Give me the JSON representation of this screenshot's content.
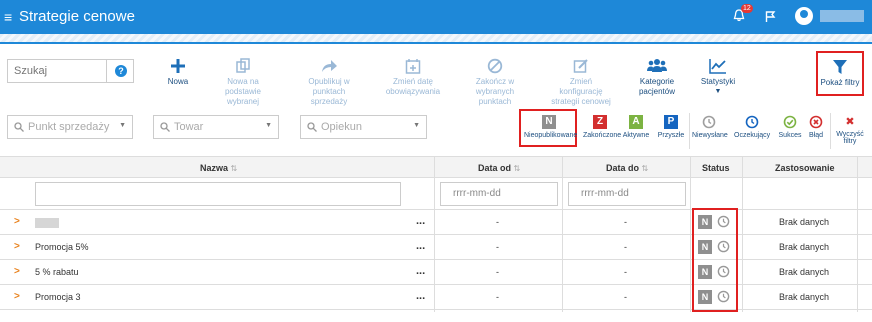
{
  "header": {
    "menu_icon": "≡",
    "title": "Strategie cenowe",
    "notifications": "12"
  },
  "search": {
    "placeholder": "Szukaj",
    "help": "?"
  },
  "toolbar": [
    {
      "label": "Nowa",
      "icon": "plus-icon"
    },
    {
      "label": "Nowa na podstawie wybranej",
      "icon": "copy-icon"
    },
    {
      "label": "Opublikuj w punktach sprzedaży",
      "icon": "share-arrow-icon"
    },
    {
      "label": "Zmień datę obowiązywania",
      "icon": "calendar-plus-icon"
    },
    {
      "label": "Zakończ w wybranych punktach",
      "icon": "ban-icon"
    },
    {
      "label": "Zmień konfigurację strategii cenowej",
      "icon": "edit-icon"
    },
    {
      "label": "Kategorie pacjentów",
      "icon": "users-icon"
    },
    {
      "label": "Statystyki",
      "icon": "chart-line-icon"
    }
  ],
  "filter_button": {
    "label": "Pokaż filtry"
  },
  "dropdowns": {
    "sales_point": "Punkt sprzedaży",
    "product": "Towar",
    "caretaker": "Opiekun"
  },
  "status_filters": [
    {
      "letter": "N",
      "label": "Nieopublikowane",
      "color": "#8f8f8f"
    },
    {
      "letter": "Z",
      "label": "Zakończone",
      "color": "#d32f2f"
    },
    {
      "letter": "A",
      "label": "Aktywne",
      "color": "#7cb342"
    },
    {
      "letter": "P",
      "label": "Przyszłe",
      "color": "#1565c0"
    }
  ],
  "result_filters": [
    {
      "label": "Niewysłane",
      "color": "#9e9e9e"
    },
    {
      "label": "Oczekujący",
      "color": "#1565c0"
    },
    {
      "label": "Sukces",
      "color": "#7cb342"
    },
    {
      "label": "Błąd",
      "color": "#d32f2f"
    }
  ],
  "clear_filters": {
    "icon": "✖",
    "label1": "Wyczyść",
    "label2": "filtry"
  },
  "table": {
    "columns": {
      "name": "Nazwa",
      "date_from": "Data od",
      "date_to": "Data do",
      "status": "Status",
      "apply": "Zastosowanie"
    },
    "sort_icon": "⇅",
    "date_placeholder": "rrrr-mm-dd",
    "rows": [
      {
        "name": "",
        "dots": "...",
        "date_from": "-",
        "date_to": "-",
        "status": "N",
        "apply": "Brak danych"
      },
      {
        "name": "Promocja 5%",
        "dots": "...",
        "date_from": "-",
        "date_to": "-",
        "status": "N",
        "apply": "Brak danych"
      },
      {
        "name": "5 % rabatu",
        "dots": "...",
        "date_from": "-",
        "date_to": "-",
        "status": "N",
        "apply": "Brak danych"
      },
      {
        "name": "Promocja 3",
        "dots": "...",
        "date_from": "-",
        "date_to": "-",
        "status": "N",
        "apply": "Brak danych"
      }
    ]
  }
}
